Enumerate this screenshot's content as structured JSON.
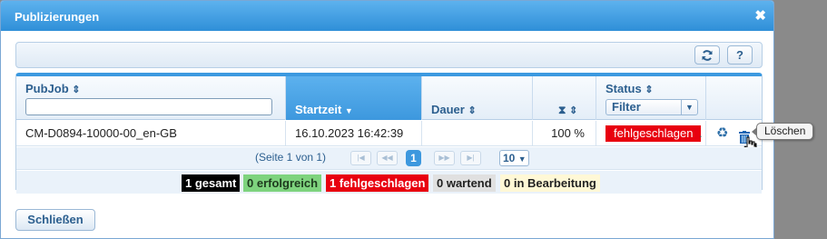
{
  "window": {
    "title": "Publizierungen",
    "close_symbol": "✖"
  },
  "toolbar": {
    "refresh_icon": "refresh-icon",
    "help_label": "?"
  },
  "table": {
    "columns": {
      "pubjob": "PubJob",
      "startzeit": "Startzeit",
      "dauer": "Dauer",
      "status": "Status"
    },
    "sort_icon": "⇕",
    "status_filter": "Filter",
    "rows": [
      {
        "pubjob": "CM-D0894-10000-00_en-GB",
        "startzeit": "16.10.2023 16:42:39",
        "dauer": "",
        "progress": "100 %",
        "status": "fehlgeschlagen"
      }
    ]
  },
  "pager": {
    "info": "(Seite 1 von 1)",
    "current_page": "1",
    "page_size": "10"
  },
  "summary": {
    "total": "1 gesamt",
    "success": "0 erfolgreich",
    "failed": "1 fehlgeschlagen",
    "waiting": "0 wartend",
    "processing": "0 in Bearbeitung"
  },
  "tooltip": {
    "text": "Löschen"
  },
  "footer": {
    "close_label": "Schließen"
  },
  "colors": {
    "title_bar": "#3d98de",
    "failed": "#e8000f",
    "success": "#7ed37e",
    "total": "#000000",
    "waiting": "#e0e0e0",
    "processing": "#fff8d6"
  }
}
